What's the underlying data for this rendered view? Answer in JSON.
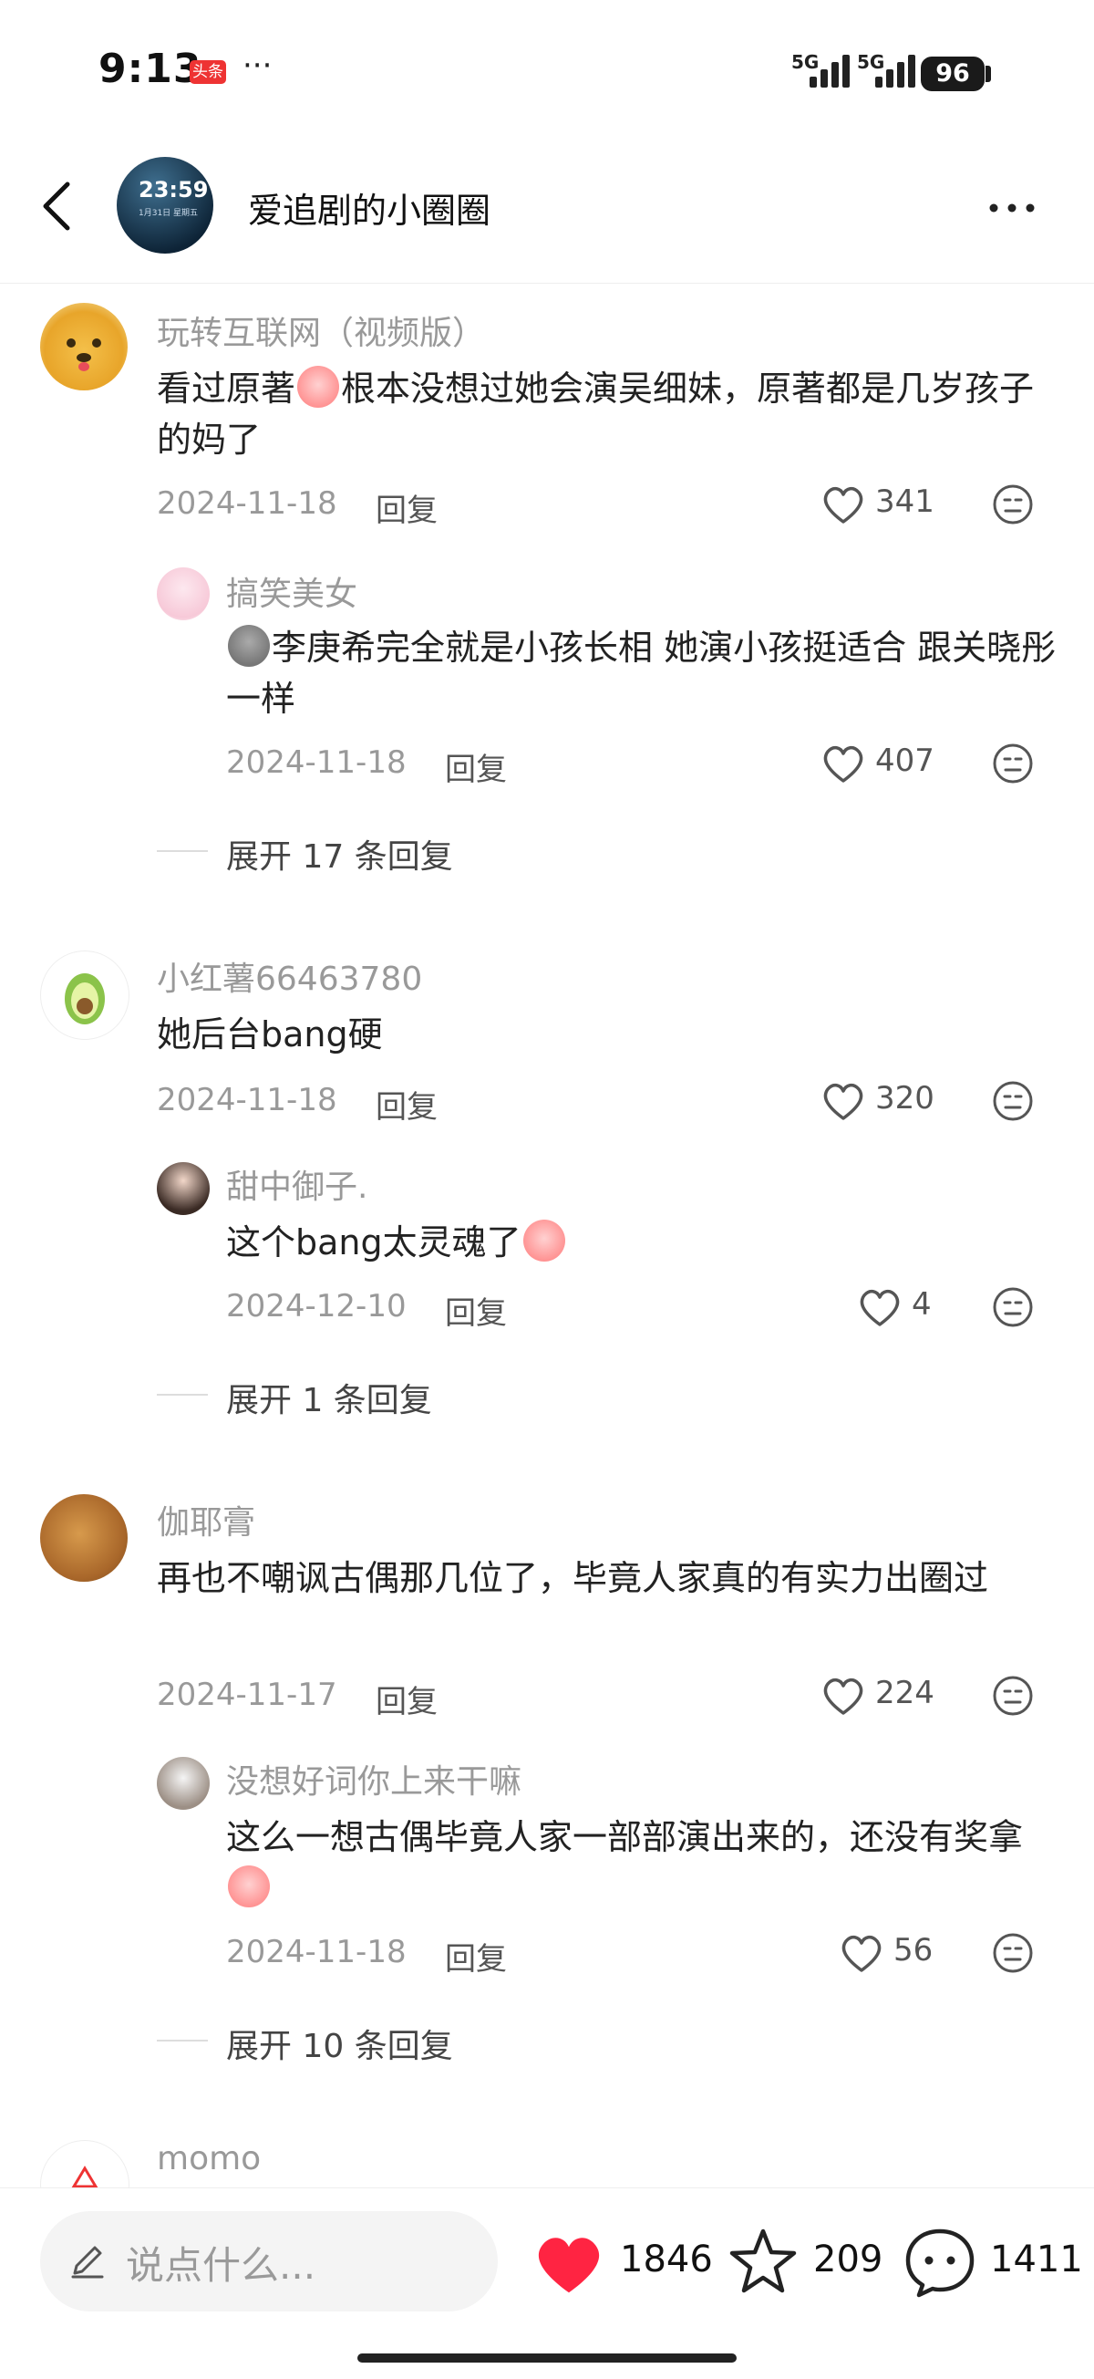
{
  "status": {
    "time": "9:13",
    "app_badge": "头条",
    "dots": "···",
    "signal1": "5G",
    "signal2": "5G",
    "battery": "96"
  },
  "header": {
    "avatar_time": "23:59",
    "avatar_sub": "1月31日 星期五",
    "title": "爱追剧的小圈圈"
  },
  "comments": [
    {
      "user": "玩转互联网（视频版）",
      "text_a": "看过原著",
      "text_b": "根本没想过她会演吴细妹，原著都是几岁孩子的妈了",
      "date": "2024-11-18",
      "reply": "回复",
      "likes": "341",
      "sub": {
        "user": "搞笑美女",
        "text": "李庚希完全就是小孩长相 她演小孩挺适合 跟关晓彤一样",
        "date": "2024-11-18",
        "reply": "回复",
        "likes": "407"
      },
      "expand": "展开 17 条回复"
    },
    {
      "user": "小红薯66463780",
      "text": "她后台bang硬",
      "date": "2024-11-18",
      "reply": "回复",
      "likes": "320",
      "sub": {
        "user": "甜中御子.",
        "text": "这个bang太灵魂了",
        "date": "2024-12-10",
        "reply": "回复",
        "likes": "4"
      },
      "expand": "展开 1 条回复"
    },
    {
      "user": "伽耶膏",
      "text": "再也不嘲讽古偶那几位了，毕竟人家真的有实力出圈过",
      "date": "2024-11-17",
      "reply": "回复",
      "likes": "224",
      "sub": {
        "user": "没想好词你上来干嘛",
        "text": "这么一想古偶毕竟人家一部部演出来的，还没有奖拿",
        "date": "2024-11-18",
        "reply": "回复",
        "likes": "56"
      },
      "expand": "展开 10 条回复"
    },
    {
      "user": "momo"
    }
  ],
  "bottom": {
    "placeholder": "说点什么...",
    "likes": "1846",
    "stars": "209",
    "comments": "1411"
  },
  "colors": {
    "accent_like": "#ff2442",
    "muted_text": "#999999"
  }
}
